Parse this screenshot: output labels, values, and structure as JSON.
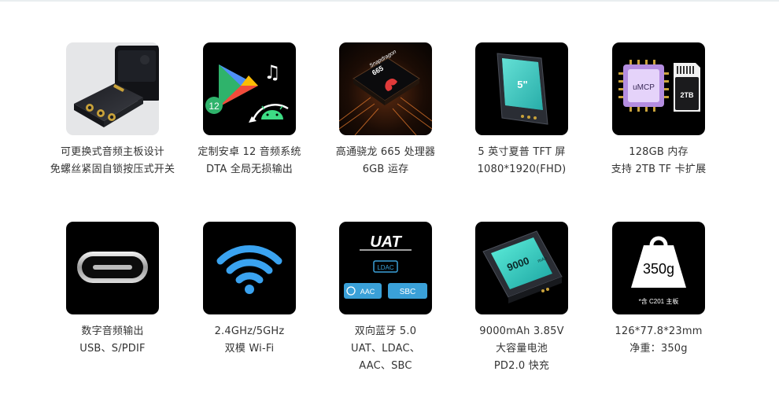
{
  "features": [
    {
      "icon": "swappable-board-icon",
      "lines": [
        "可更换式音频主板设计",
        "免螺丝紧固自锁按压式开关"
      ]
    },
    {
      "icon": "android-play-icon",
      "badge": "12",
      "lines": [
        "定制安卓 12 音频系统",
        "DTA 全局无损输出"
      ]
    },
    {
      "icon": "snapdragon-chip-icon",
      "chip_text": "Snapdragon",
      "chip_model": "665",
      "lines": [
        "高通骁龙 665 处理器",
        "6GB 运存"
      ]
    },
    {
      "icon": "screen-device-icon",
      "screen_text": "5\"",
      "lines": [
        "5 英寸夏普 TFT 屏",
        "1080*1920(FHD)"
      ]
    },
    {
      "icon": "storage-chip-icon",
      "chip_text": "uMCP",
      "card_text": "2TB",
      "lines": [
        "128GB 内存",
        "支持 2TB TF 卡扩展"
      ]
    },
    {
      "icon": "usb-c-port-icon",
      "lines": [
        "数字音频输出",
        "USB、S/PDIF"
      ]
    },
    {
      "icon": "wifi-icon",
      "lines": [
        "2.4GHz/5GHz",
        "双模 Wi-Fi"
      ]
    },
    {
      "icon": "bluetooth-codecs-icon",
      "codecs": {
        "uat": "UAT",
        "ldac": "LDAC",
        "aac": "AAC",
        "sbc": "SBC"
      },
      "lines": [
        "双向蓝牙 5.0",
        "UAT、LDAC、",
        "AAC、SBC"
      ]
    },
    {
      "icon": "battery-device-icon",
      "screen_text": "9000",
      "screen_unit": "mAh",
      "lines": [
        "9000mAh 3.85V",
        "大容量电池",
        "PD2.0 快充"
      ]
    },
    {
      "icon": "weight-icon",
      "weight_text": "350g",
      "note": "*含 C201 主板",
      "lines": [
        "126*77.8*23mm",
        "净重：350g"
      ]
    }
  ]
}
